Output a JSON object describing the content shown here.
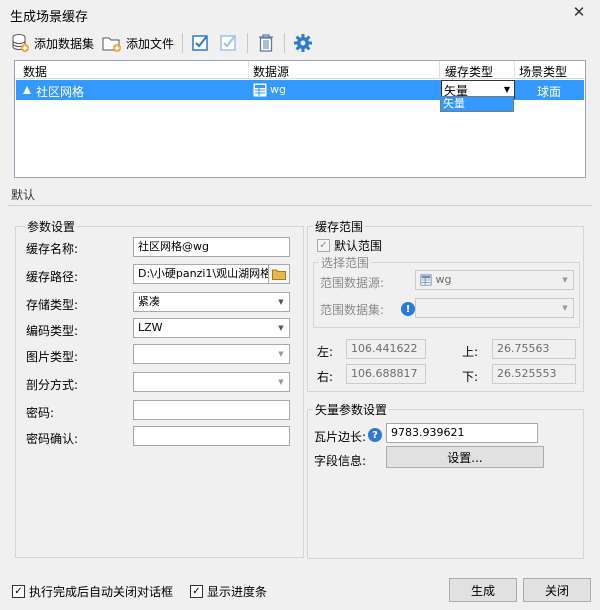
{
  "window": {
    "title": "生成场景缓存",
    "close_glyph": "✕"
  },
  "toolbar": {
    "add_dataset_label": "添加数据集",
    "add_file_label": "添加文件"
  },
  "grid": {
    "columns": [
      "数据",
      "数据源",
      "缓存类型",
      "场景类型"
    ],
    "rows": [
      {
        "data": "社区网格",
        "datasource": "wg",
        "cache_type": "矢量",
        "scene_type": "球面"
      }
    ],
    "cache_type_options": [
      "矢量"
    ]
  },
  "tabs": {
    "default_label": "默认"
  },
  "params": {
    "group_title": "参数设置",
    "cache_name_label": "缓存名称:",
    "cache_name_value": "社区网格@wg",
    "cache_path_label": "缓存路径:",
    "cache_path_value": "D:\\小硬panzi1\\观山湖网格",
    "storage_type_label": "存储类型:",
    "storage_type_value": "紧凑",
    "encoding_type_label": "编码类型:",
    "encoding_type_value": "LZW",
    "image_type_label": "图片类型:",
    "image_type_value": "",
    "split_method_label": "剖分方式:",
    "split_method_value": "",
    "password_label": "密码:",
    "password_value": "",
    "password_confirm_label": "密码确认:",
    "password_confirm_value": ""
  },
  "cache_range": {
    "group_title": "缓存范围",
    "default_range_label": "默认范围",
    "default_range_checked": true,
    "select_range_title": "选择范围",
    "range_datasource_label": "范围数据源:",
    "range_datasource_value": "wg",
    "range_dataset_label": "范围数据集:",
    "range_dataset_value": "",
    "left_label": "左:",
    "left_value": "106.441622",
    "top_label": "上:",
    "top_value": "26.75563",
    "right_label": "右:",
    "right_value": "106.688817",
    "bottom_label": "下:",
    "bottom_value": "26.525553"
  },
  "vector_params": {
    "group_title": "矢量参数设置",
    "tile_length_label": "瓦片边长:",
    "tile_length_value": "9783.939621",
    "field_info_label": "字段信息:",
    "settings_button_label": "设置..."
  },
  "footer": {
    "auto_close_label": "执行完成后自动关闭对话框",
    "auto_close_checked": true,
    "show_progress_label": "显示进度条",
    "show_progress_checked": true,
    "generate_label": "生成",
    "close_label": "关闭"
  },
  "colors": {
    "selection": "#3399ff",
    "accent_icon": "#2a7bd1",
    "folder_icon": "#e8b64a"
  }
}
